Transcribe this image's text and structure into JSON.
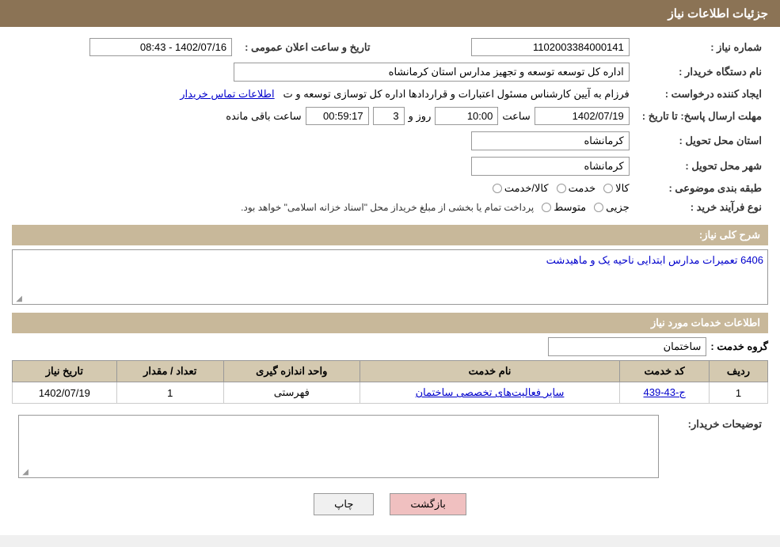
{
  "header": {
    "title": "جزئیات اطلاعات نیاز"
  },
  "fields": {
    "tender_number_label": "شماره نیاز :",
    "tender_number_value": "1102003384000141",
    "org_label": "نام دستگاه خریدار :",
    "org_value": "اداره کل توسعه  توسعه و تجهیز مدارس استان کرمانشاه",
    "creator_label": "ایجاد کننده درخواست :",
    "creator_value": "فرزام به آیین کارشناس مسئول اعتبارات و قراردادها اداره کل توسازی  توسعه و ت",
    "creator_link": "اطلاعات تماس خریدار",
    "deadline_label": "مهلت ارسال پاسخ: تا تاریخ :",
    "deadline_date": "1402/07/19",
    "deadline_time_label": "ساعت",
    "deadline_time": "10:00",
    "deadline_day_label": "روز و",
    "deadline_days": "3",
    "deadline_remaining_label": "ساعت باقی مانده",
    "deadline_remaining": "00:59:17",
    "province_label": "استان محل تحویل :",
    "province_value": "کرمانشاه",
    "city_label": "شهر محل تحویل :",
    "city_value": "کرمانشاه",
    "category_label": "طبقه بندی موضوعی :",
    "category_options": [
      {
        "label": "کالا",
        "selected": false
      },
      {
        "label": "خدمت",
        "selected": false
      },
      {
        "label": "کالا/خدمت",
        "selected": false
      }
    ],
    "purchase_type_label": "نوع فرآیند خرید :",
    "purchase_options": [
      {
        "label": "جزیی",
        "selected": false
      },
      {
        "label": "متوسط",
        "selected": false
      }
    ],
    "purchase_note": "پرداخت تمام یا بخشی از مبلغ خریداز محل \"اسناد خزانه اسلامی\" خواهد بود.",
    "announce_date_label": "تاریخ و ساعت اعلان عمومی :",
    "announce_date_value": "1402/07/16 - 08:43"
  },
  "description_section": {
    "title": "شرح کلی نیاز:",
    "value": "6406 تعمیرات مدارس ابتدایی ناحیه یک و ماهیدشت"
  },
  "services_section": {
    "title": "اطلاعات خدمات مورد نیاز",
    "group_label": "گروه خدمت :",
    "group_value": "ساختمان",
    "table": {
      "columns": [
        "ردیف",
        "کد خدمت",
        "نام خدمت",
        "واحد اندازه گیری",
        "تعداد / مقدار",
        "تاریخ نیاز"
      ],
      "rows": [
        {
          "index": "1",
          "code": "ج-43-439",
          "name": "سایر فعالیت‌های تخصصی ساختمان",
          "unit": "فهرستی",
          "quantity": "1",
          "date": "1402/07/19"
        }
      ]
    }
  },
  "buyer_desc": {
    "label": "توضیحات خریدار:"
  },
  "buttons": {
    "print": "چاپ",
    "back": "بازگشت"
  }
}
